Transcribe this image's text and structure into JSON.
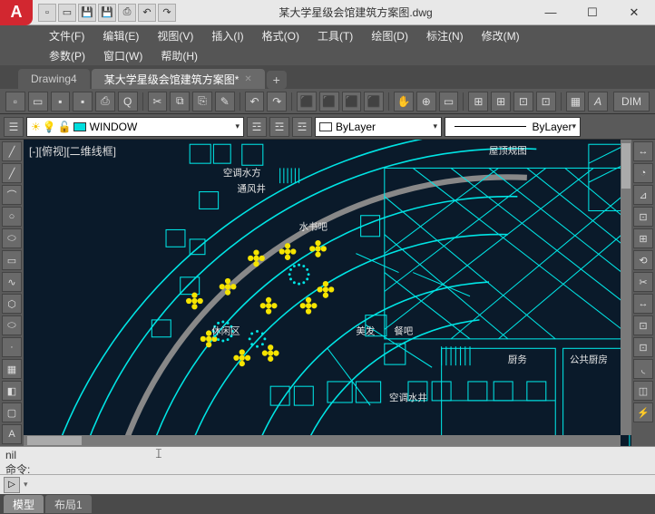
{
  "app": {
    "title": "某大学星级会馆建筑方案图.dwg",
    "logo": "A"
  },
  "qat": [
    "new",
    "open",
    "save",
    "saveas",
    "print",
    "undo",
    "redo"
  ],
  "wincontrols": {
    "min": "—",
    "max": "☐",
    "close": "✕"
  },
  "menu1": [
    "文件(F)",
    "编辑(E)",
    "视图(V)",
    "插入(I)",
    "格式(O)",
    "工具(T)",
    "绘图(D)",
    "标注(N)",
    "修改(M)"
  ],
  "menu2": [
    "参数(P)",
    "窗口(W)",
    "帮助(H)"
  ],
  "tabs": [
    {
      "label": "Drawing4",
      "active": false
    },
    {
      "label": "某大学星级会馆建筑方案图*",
      "active": true
    }
  ],
  "toolbar_icons": [
    "▢",
    "▢",
    "▢",
    "▤",
    "⎙",
    "|",
    "✂",
    "⧉",
    "⎘",
    "|",
    "↶",
    "↷",
    "|",
    "☰",
    "⬛",
    "⬛",
    "⬛",
    "|",
    "▥",
    "▦",
    "|",
    "✋",
    "⊕",
    "Q",
    "|",
    "⊞",
    "⊞",
    "⊡",
    "⊡",
    "|",
    "▭",
    "▭",
    "A"
  ],
  "toolbar_right": "DIM",
  "layer": {
    "icons": [
      "☼",
      "❄",
      "⬜"
    ],
    "current": "WINDOW",
    "color_sw": "#00dddd",
    "color_name": "ByLayer",
    "linetype": "ByLayer"
  },
  "left_tool_icons": [
    "╱",
    "╱",
    "⌒",
    "⬭",
    "⬭",
    "⬜",
    "∿",
    "⬨",
    "⬡",
    "·",
    "◧",
    "▦",
    "A",
    "▭"
  ],
  "right_tool_icons": [
    "╱",
    "◔",
    "⊿",
    "∿",
    "⎊",
    "⟲",
    "✂",
    "↔",
    "⊡",
    "⊡",
    "⊡",
    "◫",
    "┃"
  ],
  "viewport_label": "[-][俯视][二维线框]",
  "drawing_labels": {
    "roof": "屋顶规图",
    "kongtiao1": "空调水方",
    "tongfeng": "通风井",
    "shuishu": "水书吧",
    "xiuxian": "休闲区",
    "meifa": "美发",
    "canba": "餐吧",
    "kongtiao2": "空调水井",
    "shiwu": "厨务",
    "gonggong": "公共厨房"
  },
  "cmd": {
    "history_line1": "nil",
    "history_line2": "命令:",
    "prompt_icon": "▷",
    "input_value": ""
  },
  "status": {
    "model": "模型",
    "layout1": "布局1"
  }
}
